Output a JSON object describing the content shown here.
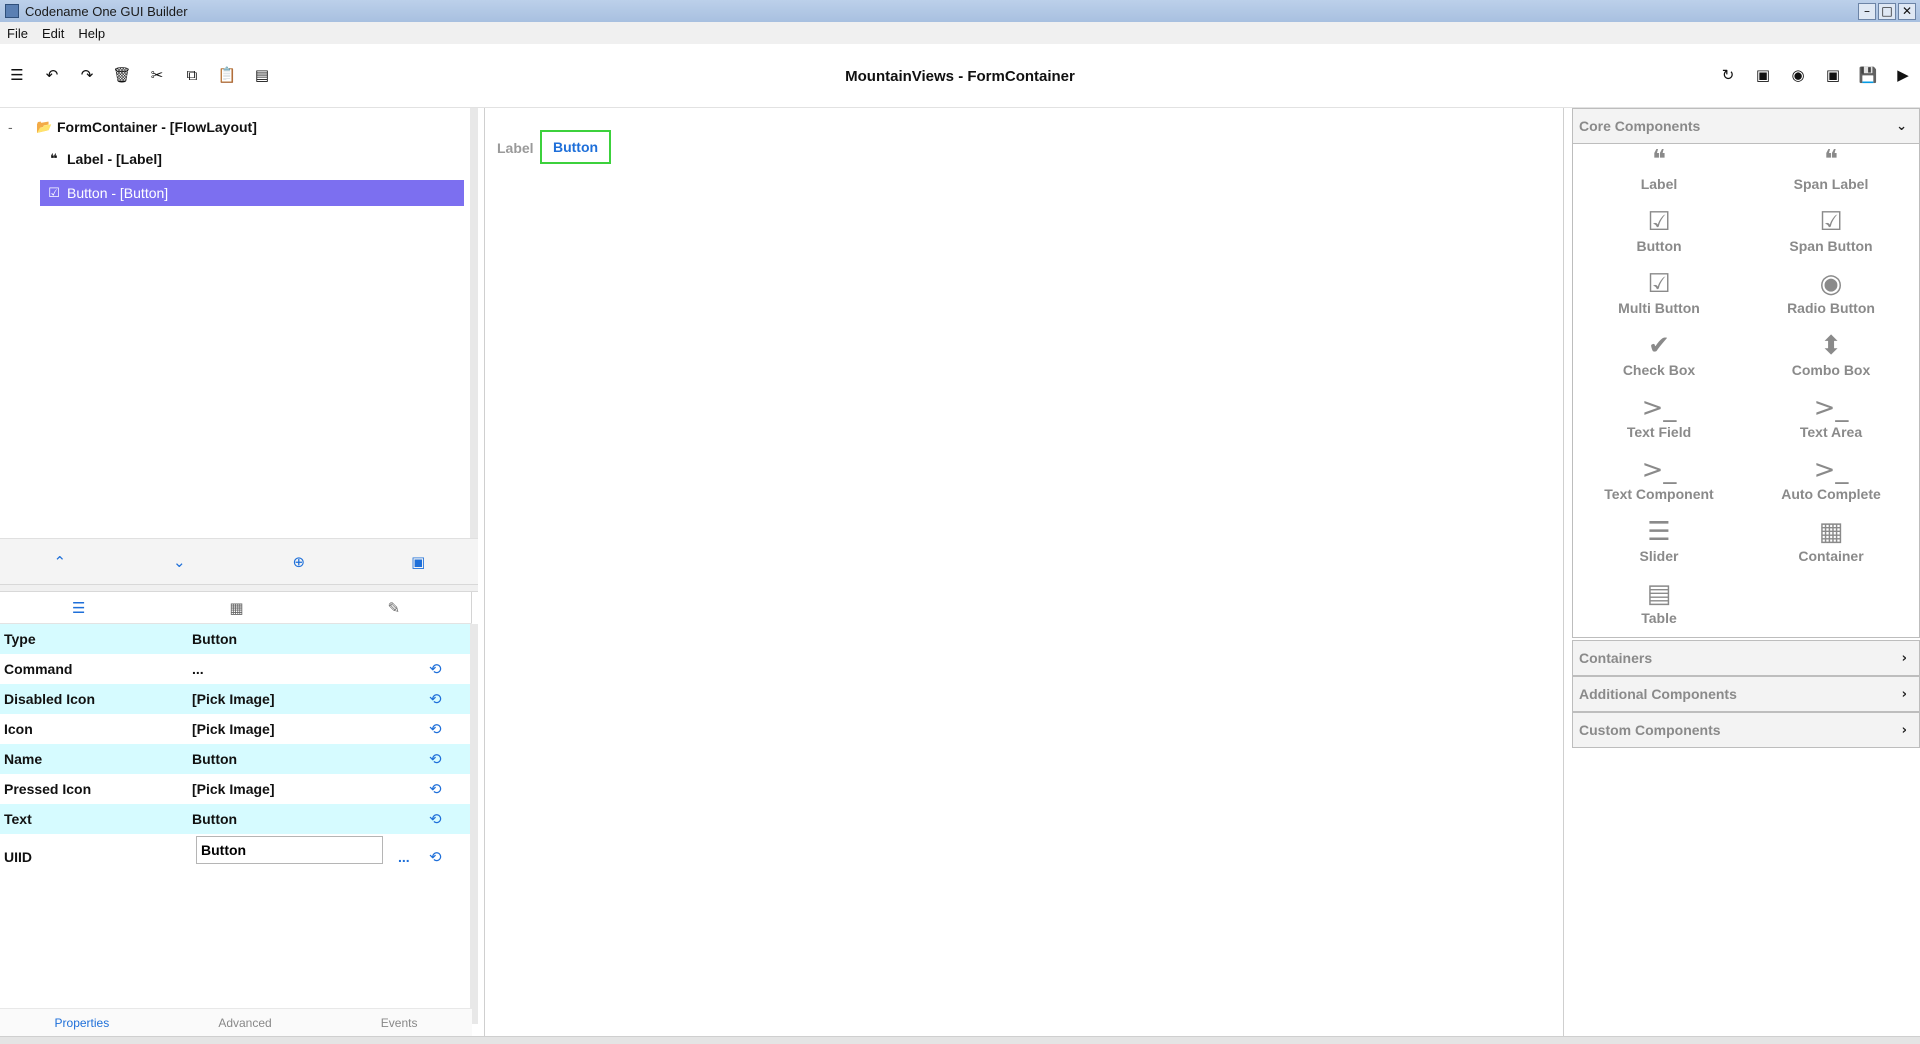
{
  "window": {
    "title": "Codename One GUI Builder",
    "buttons": [
      "–",
      "□",
      "✕"
    ]
  },
  "menu": {
    "items": [
      "File",
      "Edit",
      "Help"
    ]
  },
  "toolbar": {
    "title": "MountainViews - FormContainer",
    "left_icons": [
      "menu-icon",
      "undo-icon",
      "redo-icon",
      "delete-icon",
      "cut-icon",
      "copy-icon",
      "paste-icon",
      "list-icon"
    ],
    "right_icons": [
      "refresh-icon",
      "image-icon",
      "radio-icon",
      "image-icon",
      "save-icon",
      "play-icon"
    ]
  },
  "tree": {
    "collapse_glyph": "-",
    "nodes": [
      {
        "label": "FormContainer - [FlowLayout]",
        "icon": "folder-open-icon",
        "glyph": "📂"
      },
      {
        "label": "Label - [Label]",
        "icon": "quote-icon",
        "glyph": "❝"
      },
      {
        "label": "Button - [Button]",
        "icon": "checkbox-icon",
        "glyph": "☑",
        "selected": true
      }
    ],
    "actions": [
      "move-up-icon",
      "move-down-icon",
      "add-icon",
      "archive-icon"
    ]
  },
  "properties": {
    "tabs": [
      "list-icon",
      "grid-icon",
      "paint-icon"
    ],
    "rows": [
      {
        "name": "Type",
        "value": "Button",
        "reset": false
      },
      {
        "name": "Command",
        "value": "...",
        "reset": true
      },
      {
        "name": "Disabled Icon",
        "value": "[Pick Image]",
        "reset": true
      },
      {
        "name": "Icon",
        "value": "[Pick Image]",
        "reset": true
      },
      {
        "name": "Name",
        "value": "Button",
        "reset": true
      },
      {
        "name": "Pressed Icon",
        "value": "[Pick Image]",
        "reset": true
      },
      {
        "name": "Text",
        "value": "Button",
        "reset": true
      }
    ],
    "uiid": {
      "name": "UIID",
      "value": "Button",
      "dots": "..."
    },
    "bottom_tabs": [
      "Properties",
      "Advanced",
      "Events"
    ]
  },
  "canvas": {
    "label_text": "Label",
    "button_text": "Button"
  },
  "palette": {
    "core_title": "Core Components",
    "core_items": [
      {
        "label": "Label",
        "icon": "quote-icon",
        "glyph": "❝"
      },
      {
        "label": "Span Label",
        "icon": "quote-icon",
        "glyph": "❝"
      },
      {
        "label": "Button",
        "icon": "checkbox-icon",
        "glyph": "☑"
      },
      {
        "label": "Span Button",
        "icon": "checkbox-icon",
        "glyph": "☑"
      },
      {
        "label": "Multi Button",
        "icon": "checkbox-icon",
        "glyph": "☑"
      },
      {
        "label": "Radio Button",
        "icon": "radio-icon",
        "glyph": "◉"
      },
      {
        "label": "Check Box",
        "icon": "check-box-icon",
        "glyph": "✔"
      },
      {
        "label": "Combo Box",
        "icon": "sort-icon",
        "glyph": "⬍"
      },
      {
        "label": "Text Field",
        "icon": "terminal-icon",
        "glyph": ">_"
      },
      {
        "label": "Text Area",
        "icon": "terminal-icon",
        "glyph": ">_"
      },
      {
        "label": "Text Component",
        "icon": "terminal-icon",
        "glyph": ">_"
      },
      {
        "label": "Auto Complete",
        "icon": "terminal-icon",
        "glyph": ">_"
      },
      {
        "label": "Slider",
        "icon": "sliders-icon",
        "glyph": "☰"
      },
      {
        "label": "Container",
        "icon": "grid-icon",
        "glyph": "▦"
      },
      {
        "label": "Table",
        "icon": "table-icon",
        "glyph": "▤"
      }
    ],
    "sections": [
      "Containers",
      "Additional Components",
      "Custom Components"
    ]
  }
}
